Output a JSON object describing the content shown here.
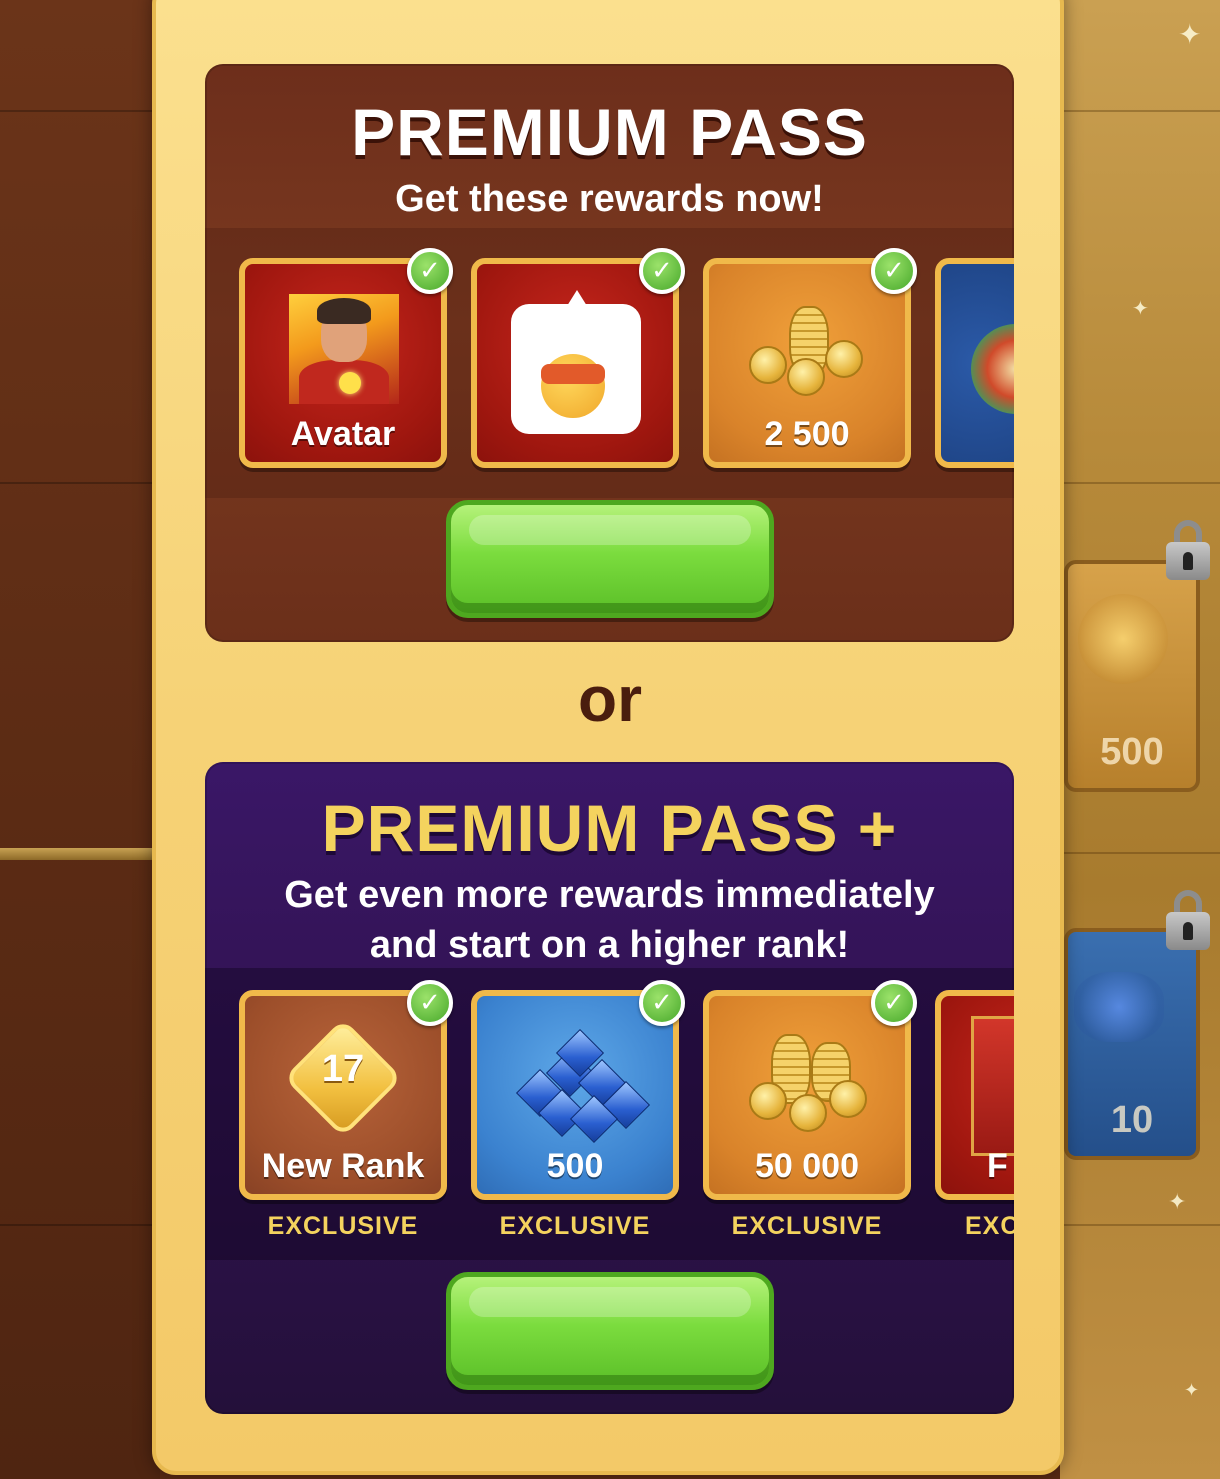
{
  "premium_pass": {
    "title": "PREMIUM PASS",
    "subtitle": "Get these rewards now!",
    "rewards": [
      {
        "label": "Avatar",
        "icon": "avatar-portrait-icon",
        "claimed": true
      },
      {
        "label": "",
        "icon": "emoji-sticker-icon",
        "claimed": true
      },
      {
        "label": "2 500",
        "icon": "gold-coins-icon",
        "claimed": true
      },
      {
        "label": "",
        "icon": "partial-reward-icon",
        "claimed": false
      }
    ],
    "button_color": "#7bdc3e"
  },
  "separator": {
    "text": "or"
  },
  "premium_pass_plus": {
    "title": "PREMIUM PASS +",
    "subtitle": "Get even more rewards immediately and start on a higher rank!",
    "rewards": [
      {
        "label": "New Rank",
        "rank_number": "17",
        "tag": "EXCLUSIVE",
        "icon": "rank-badge-icon",
        "claimed": true
      },
      {
        "label": "500",
        "tag": "EXCLUSIVE",
        "icon": "blue-gems-icon",
        "claimed": true
      },
      {
        "label": "50 000",
        "tag": "EXCLUSIVE",
        "icon": "gold-coins-icon",
        "claimed": true
      },
      {
        "label": "F",
        "tag": "EXC",
        "icon": "partial-reward-icon",
        "claimed": false
      }
    ],
    "button_color": "#7bdc3e"
  },
  "background": {
    "side_rewards": [
      {
        "label": "500",
        "locked": true,
        "icon": "gold-coins-icon"
      },
      {
        "label": "10",
        "locked": true,
        "icon": "blue-gems-icon"
      }
    ]
  },
  "colors": {
    "panel": "#f6d276",
    "premium_card": "#7b3a20",
    "premium_plus_card": "#341458",
    "title_gold": "#f4d35e",
    "tile_border": "#f0b94a"
  }
}
